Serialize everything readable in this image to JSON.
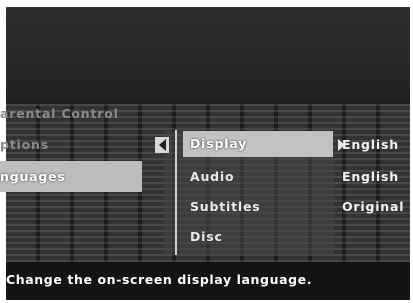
{
  "left_menu": {
    "items": [
      {
        "label": "arental Control"
      },
      {
        "label": "ptions"
      },
      {
        "label": "nguages"
      },
      {
        "label": ""
      }
    ]
  },
  "submenu": {
    "items": [
      {
        "label": "Display",
        "value": "English"
      },
      {
        "label": "Audio",
        "value": "English"
      },
      {
        "label": "Subtitles",
        "value": "Original"
      },
      {
        "label": "Disc",
        "value": ""
      }
    ],
    "selected_index": 0
  },
  "icons": {
    "left": "arrow-left-icon",
    "right": "arrow-right-icon"
  },
  "help_text": "Change the on-screen display language."
}
